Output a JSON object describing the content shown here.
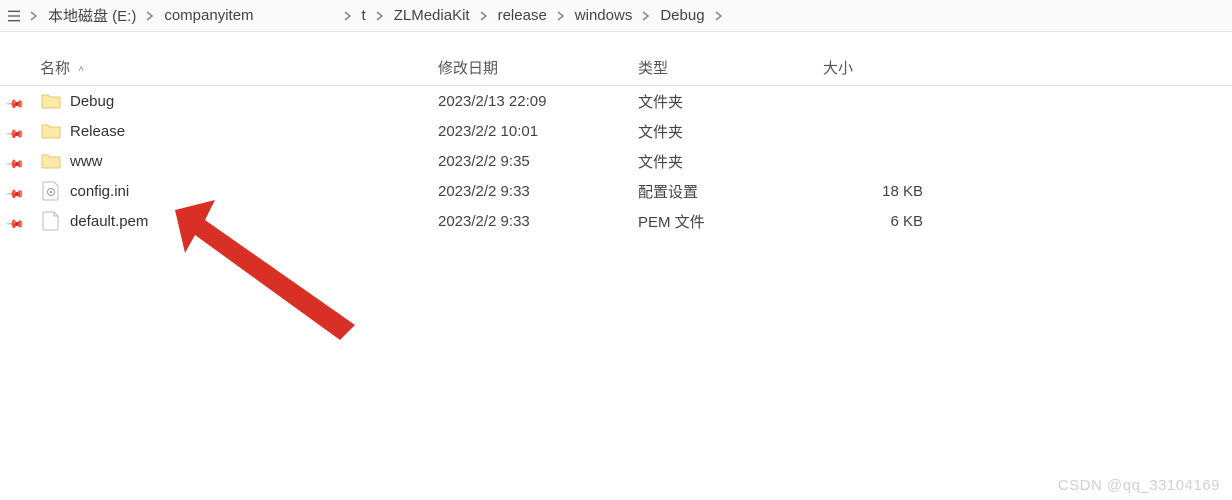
{
  "breadcrumb": {
    "home_icon": "home",
    "items": [
      {
        "label": "本地磁盘 (E:)"
      },
      {
        "label": "companyitem"
      },
      {
        "label": ""
      },
      {
        "label": "t"
      },
      {
        "label": "ZLMediaKit"
      },
      {
        "label": "release"
      },
      {
        "label": "windows"
      },
      {
        "label": "Debug"
      }
    ]
  },
  "columns": {
    "name": "名称",
    "date": "修改日期",
    "type": "类型",
    "size": "大小"
  },
  "files": [
    {
      "icon": "folder",
      "name": "Debug",
      "date": "2023/2/13 22:09",
      "type": "文件夹",
      "size": ""
    },
    {
      "icon": "folder",
      "name": "Release",
      "date": "2023/2/2 10:01",
      "type": "文件夹",
      "size": ""
    },
    {
      "icon": "folder",
      "name": "www",
      "date": "2023/2/2 9:35",
      "type": "文件夹",
      "size": ""
    },
    {
      "icon": "ini",
      "name": "config.ini",
      "date": "2023/2/2 9:33",
      "type": "配置设置",
      "size": "18 KB"
    },
    {
      "icon": "file",
      "name": "default.pem",
      "date": "2023/2/2 9:33",
      "type": "PEM 文件",
      "size": "6 KB"
    }
  ],
  "watermark": "CSDN @qq_33104169",
  "colors": {
    "arrow": "#d93025",
    "folder_fill": "#ffe9a6",
    "folder_stroke": "#e0c978"
  }
}
